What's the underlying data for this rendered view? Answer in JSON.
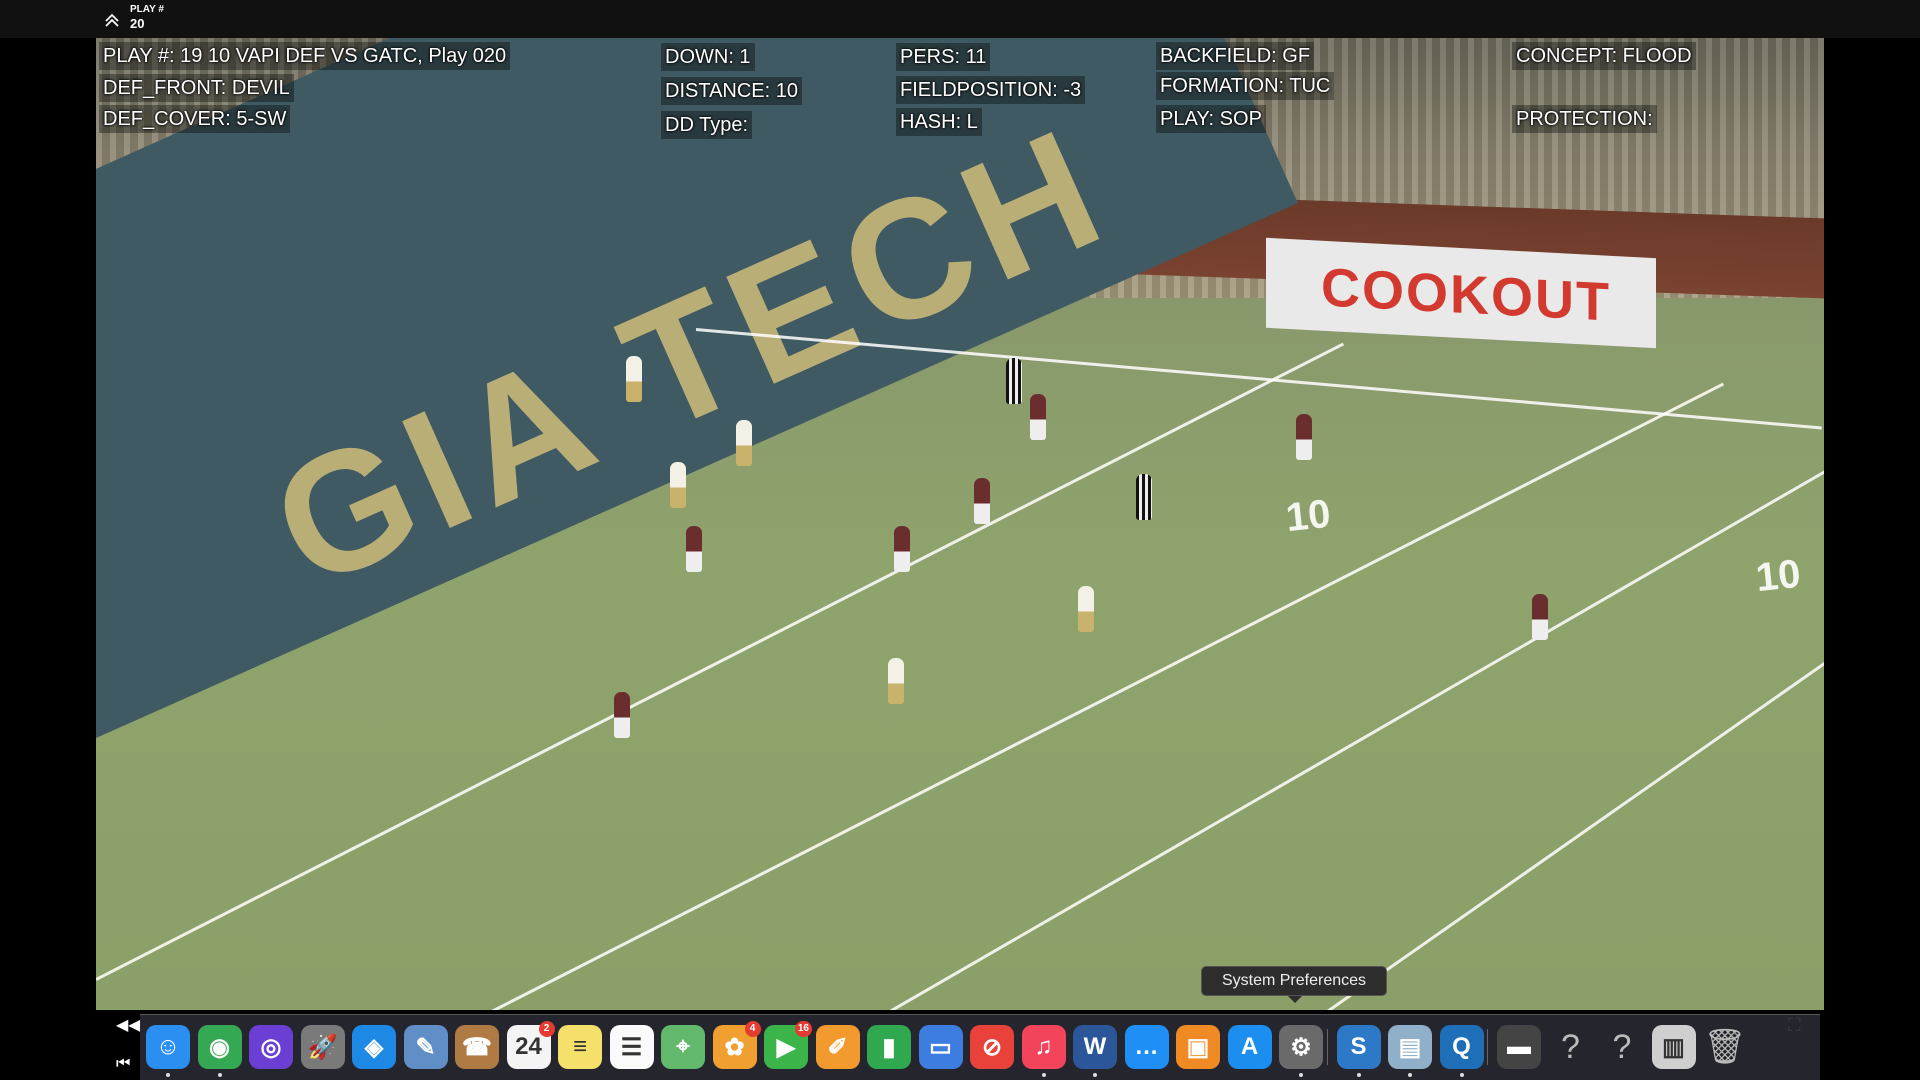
{
  "header": {
    "play_label": "PLAY #",
    "play_number": "20"
  },
  "overlay": {
    "play": "PLAY #: 19 10 VAPI DEF VS GATC, Play 020",
    "def_front": "DEF_FRONT: DEVIL",
    "def_cover": "DEF_COVER: 5-SW",
    "down": "DOWN: 1",
    "distance": "DISTANCE: 10",
    "dd_type": "DD Type:",
    "pers": "PERS: 11",
    "field_position": "FIELDPOSITION: -3",
    "hash": "HASH: L",
    "backfield": "BACKFIELD: GF",
    "formation": "FORMATION: TUC",
    "play_call": "PLAY: SOP",
    "concept": "CONCEPT: FLOOD",
    "protection": "PROTECTION:"
  },
  "scene": {
    "banner": "COOKOUT",
    "endzone_text": "GIA TECH",
    "yard_numbers": [
      "10",
      "10"
    ]
  },
  "tooltip": "System Preferences",
  "dock": {
    "items": [
      {
        "name": "finder-icon",
        "glyph": "☺",
        "color": "#2a8ff0",
        "running": true
      },
      {
        "name": "chrome-icon",
        "glyph": "◉",
        "color": "#34a853",
        "running": true
      },
      {
        "name": "siri-icon",
        "glyph": "◎",
        "color": "#6b3fd4",
        "running": false
      },
      {
        "name": "launchpad-icon",
        "glyph": "🚀",
        "color": "#7a7a7a",
        "running": false
      },
      {
        "name": "safari-icon",
        "glyph": "◈",
        "color": "#1e88e5",
        "running": false
      },
      {
        "name": "preview-icon",
        "glyph": "✎",
        "color": "#5f8fc6",
        "running": false
      },
      {
        "name": "contacts-icon",
        "glyph": "☎",
        "color": "#b07a45",
        "running": false
      },
      {
        "name": "calendar-icon",
        "glyph": "24",
        "color": "#f4f4f4",
        "running": false,
        "badge": "2"
      },
      {
        "name": "notes-icon",
        "glyph": "≡",
        "color": "#f5e06b",
        "running": false
      },
      {
        "name": "reminders-icon",
        "glyph": "☰",
        "color": "#fafafa",
        "running": false
      },
      {
        "name": "maps-icon",
        "glyph": "⌖",
        "color": "#62b86b",
        "running": false
      },
      {
        "name": "photos-icon",
        "glyph": "✿",
        "color": "#f0a030",
        "running": false,
        "badge": "4"
      },
      {
        "name": "facetime-icon",
        "glyph": "▶",
        "color": "#3bb54a",
        "running": false,
        "badge": "16"
      },
      {
        "name": "pages-icon",
        "glyph": "✐",
        "color": "#f29a2e",
        "running": false
      },
      {
        "name": "numbers-icon",
        "glyph": "▮",
        "color": "#2fa84f",
        "running": false
      },
      {
        "name": "keynote-icon",
        "glyph": "▭",
        "color": "#3d7de0",
        "running": false
      },
      {
        "name": "news-icon",
        "glyph": "⊘",
        "color": "#e8423b",
        "running": false
      },
      {
        "name": "music-icon",
        "glyph": "♫",
        "color": "#f3445c",
        "running": true
      },
      {
        "name": "word-icon",
        "glyph": "W",
        "color": "#2b579a",
        "running": true
      },
      {
        "name": "messages-icon",
        "glyph": "…",
        "color": "#1f8ff5",
        "running": false
      },
      {
        "name": "books-icon",
        "glyph": "▣",
        "color": "#f08a24",
        "running": false
      },
      {
        "name": "app-store-icon",
        "glyph": "A",
        "color": "#1c8ef0",
        "running": false
      },
      {
        "name": "system-preferences-icon",
        "glyph": "⚙",
        "color": "#6a6a6a",
        "running": true
      },
      {
        "name": "scrivener-icon",
        "glyph": "S",
        "color": "#2e78c8",
        "running": true
      },
      {
        "name": "image-capture-icon",
        "glyph": "▤",
        "color": "#8fb0c8",
        "running": true
      },
      {
        "name": "quicktime-icon",
        "glyph": "Q",
        "color": "#1e6fb8",
        "running": true
      },
      {
        "name": "video-thumbnail-icon",
        "glyph": "▬",
        "color": "#444",
        "running": false
      },
      {
        "name": "help-icon",
        "glyph": "?",
        "color": "transparent",
        "running": false
      },
      {
        "name": "help-icon-2",
        "glyph": "?",
        "color": "transparent",
        "running": false
      },
      {
        "name": "downloads-folder-icon",
        "glyph": "▥",
        "color": "#cfcfcf",
        "running": false
      },
      {
        "name": "trash-icon",
        "glyph": "🗑",
        "color": "transparent",
        "running": false
      }
    ]
  }
}
